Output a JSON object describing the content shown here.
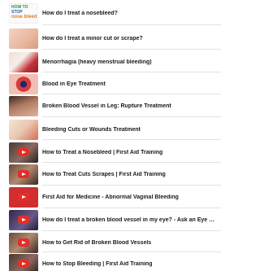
{
  "items": [
    {
      "title": "How do I treat a nosebleed?",
      "thumb": "logo",
      "logo_lines": [
        "HOW TO",
        "STOP",
        "nose bleed"
      ]
    },
    {
      "title": "How do I treat a minor cut or scrape?",
      "thumb": "skin"
    },
    {
      "title": "Menorrhagia (heavy menstrual bleeding)",
      "thumb": "blood"
    },
    {
      "title": "Blood in Eye Treatment",
      "thumb": "eye"
    },
    {
      "title": "Broken Blood Vessel in Leg: Rupture Treatment",
      "thumb": "leg"
    },
    {
      "title": "Bleeding Cuts or Wounds Treatment",
      "thumb": "bleed"
    },
    {
      "title": "How to Treat a Nosebleed | First Aid Training",
      "thumb": "video-dark"
    },
    {
      "title": "How to Treat Cuts  Scrapes | First Aid Training",
      "thumb": "video-brown"
    },
    {
      "title": "First Aid for Medicine - Abnormal Vaginal Bleeding",
      "thumb": "video-red"
    },
    {
      "title": "How do I treat a broken blood vessel in my eye? - Ask an Eye M.D.",
      "thumb": "video-purple"
    },
    {
      "title": "How to Get Rid of Broken Blood Vessels",
      "thumb": "video-brown"
    },
    {
      "title": "How to Stop Bleeding | First Aid Training",
      "thumb": "video-dark"
    }
  ]
}
